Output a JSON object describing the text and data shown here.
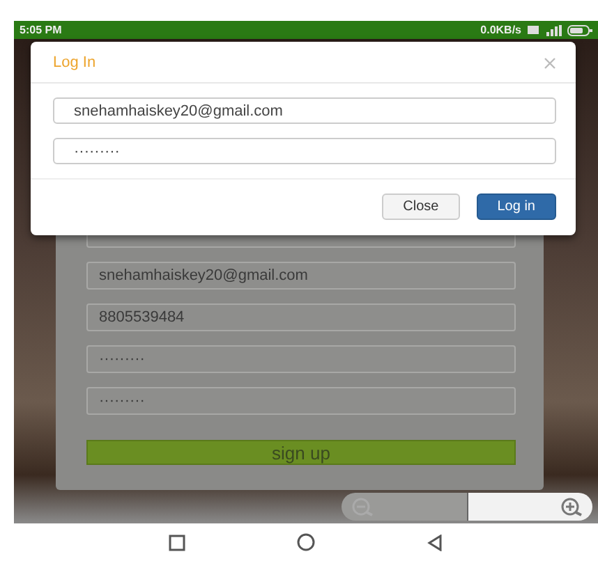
{
  "status_bar": {
    "time": "5:05 PM",
    "network_speed": "0.0KB/s"
  },
  "login_dialog": {
    "title": "Log In",
    "fields": [
      {
        "value": "snehamhaiskey20@gmail.com"
      },
      {
        "value": "·········"
      }
    ],
    "buttons": [
      {
        "label": "Close",
        "kind": "secondary"
      },
      {
        "label": "Log in",
        "kind": "primary"
      }
    ]
  },
  "signup_form": {
    "fields": [
      {
        "value": "snehamhaiskey20@gmail.com"
      },
      {
        "value": "8805539484"
      },
      {
        "value": "·········"
      },
      {
        "value": "·········"
      }
    ],
    "submit": "sign up"
  }
}
